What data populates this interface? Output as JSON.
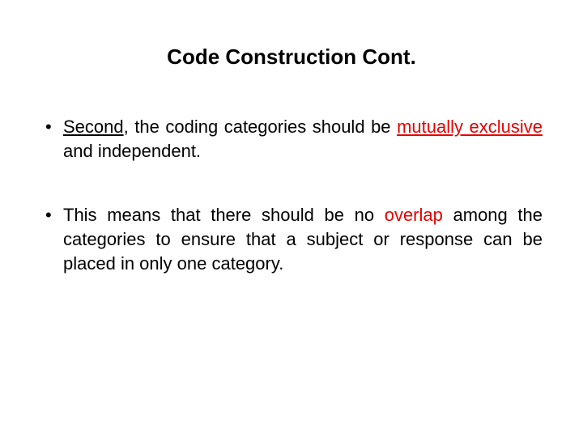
{
  "title": "Code Construction Cont.",
  "bullets": [
    {
      "second_word": "Second",
      "part1": ", the coding categories should be ",
      "mx_word": "mutually exclusive",
      "part2": " and independent."
    },
    {
      "part1": "This means that there should be no ",
      "overlap_word": "overlap",
      "part2": " among the categories to ensure that a subject or response can be placed in only one category."
    }
  ]
}
